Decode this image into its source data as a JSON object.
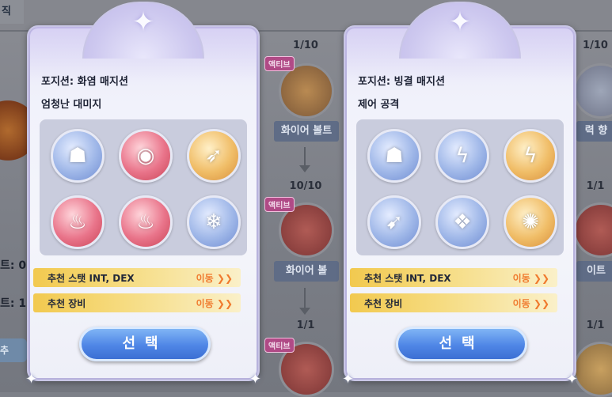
{
  "background": {
    "tab_label": "직",
    "stats": [
      {
        "label": "트: 0"
      },
      {
        "label": "트: 1"
      }
    ],
    "left_button": "추",
    "skill_columns": [
      {
        "nodes": [
          {
            "count": "1/10",
            "badge": "액티브",
            "name": "화이어 볼트"
          },
          {
            "count": "10/10",
            "badge": "액티브",
            "name": "화이어 볼"
          },
          {
            "count": "1/1",
            "badge": "액티브",
            "name": ""
          }
        ]
      },
      {
        "nodes": [
          {
            "count": "1/10",
            "name": "력 향"
          },
          {
            "count": "1/1",
            "name": "이트"
          },
          {
            "count": "1/1",
            "name": ""
          }
        ]
      }
    ]
  },
  "cards": [
    {
      "position_label": "포지션: 화염 매지션",
      "description": "엄청난 대미지",
      "icons": [
        {
          "icon": "fire-buff-icon",
          "color": "blue",
          "glyph": "☗"
        },
        {
          "icon": "fire-orb-icon",
          "color": "red",
          "glyph": "◉"
        },
        {
          "icon": "fire-arrow-icon",
          "color": "gold",
          "glyph": "➶"
        },
        {
          "icon": "flame-icon",
          "color": "red",
          "glyph": "♨"
        },
        {
          "icon": "fire-pillar-icon",
          "color": "red",
          "glyph": "♨"
        },
        {
          "icon": "ice-figure-icon",
          "color": "blue",
          "glyph": "❄"
        }
      ],
      "rec_stat_label": "추천 스탯 INT, DEX",
      "rec_stat_move": "이동 ❯❯",
      "rec_gear_label": "추천 장비",
      "rec_gear_move": "이동 ❯❯",
      "select_label": "선택"
    },
    {
      "position_label": "포지션: 빙결 매지션",
      "description": "제어 공격",
      "icons": [
        {
          "icon": "ice-buff-icon",
          "color": "blue",
          "glyph": "☗"
        },
        {
          "icon": "lightning-icon",
          "color": "blue",
          "glyph": "ϟ"
        },
        {
          "icon": "thunder-icon",
          "color": "gold",
          "glyph": "ϟ"
        },
        {
          "icon": "ice-spear-icon",
          "color": "blue",
          "glyph": "➹"
        },
        {
          "icon": "ice-shard-icon",
          "color": "blue",
          "glyph": "❖"
        },
        {
          "icon": "golden-seal-icon",
          "color": "gold",
          "glyph": "✺"
        }
      ],
      "rec_stat_label": "추천 스탯 INT, DEX",
      "rec_stat_move": "이동 ❯❯",
      "rec_gear_label": "추천 장비",
      "rec_gear_move": "이동 ❯❯",
      "select_label": "선택"
    }
  ],
  "colors": {
    "select_button": "#4f86e6",
    "rec_bar": "#f2c94f",
    "move_text": "#f07a2e",
    "active_badge": "#b04a86"
  }
}
